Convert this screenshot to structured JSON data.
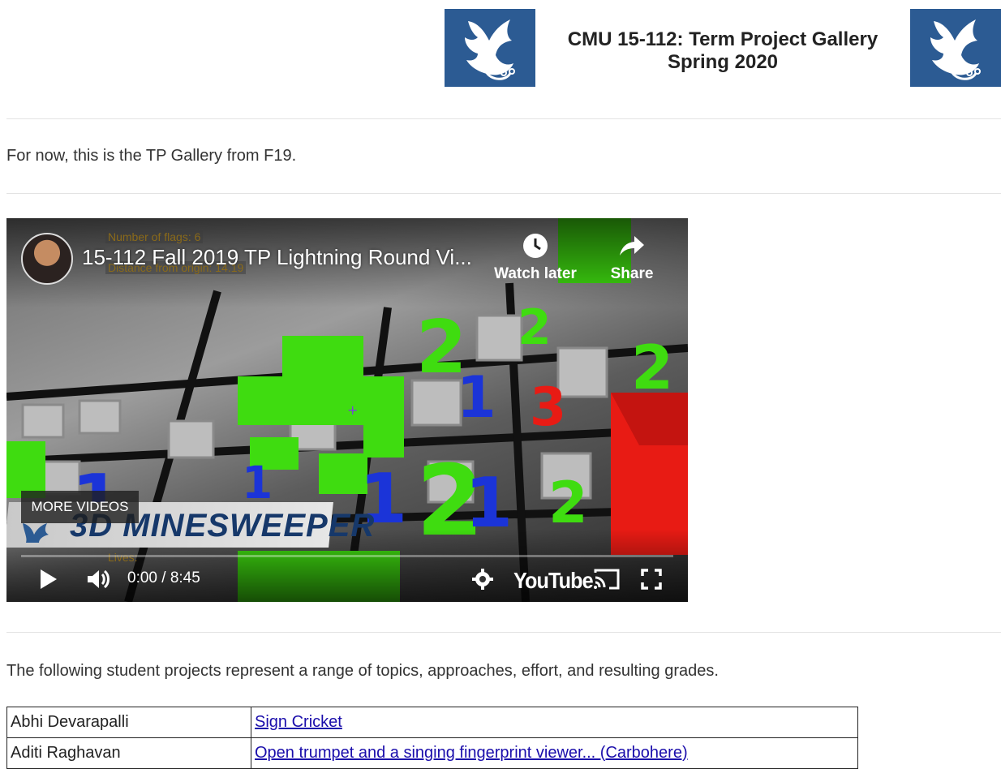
{
  "header": {
    "title_line1": "CMU 15-112: Term Project Gallery",
    "title_line2": "Spring 2020",
    "logo_icon": "scottie-dragon-icon",
    "logo_bg": "#2c5b93"
  },
  "intro_text": "For now, this is the TP Gallery from F19.",
  "video": {
    "title": "15-112 Fall 2019 TP Lightning Round Vi...",
    "watch_later_label": "Watch later",
    "share_label": "Share",
    "more_videos_label": "MORE VIDEOS",
    "time_display": "0:00 / 8:45",
    "youtube_label": "YouTube",
    "banner_text": "3D MINESWEEPER",
    "hud_flags": "Number of flags: 6",
    "hud_distance": "Distance from origin: 14.19",
    "hud_lives": "Lives:",
    "progress_fraction": 0.0
  },
  "projects_intro": "The following student projects represent a range of topics, approaches, effort, and resulting grades.",
  "projects": [
    {
      "student": "Abhi Devarapalli",
      "project": "Sign Cricket"
    },
    {
      "student": "Aditi Raghavan",
      "project": "Open trumpet and a singing fingerprint viewer... (Carbohere)"
    }
  ]
}
